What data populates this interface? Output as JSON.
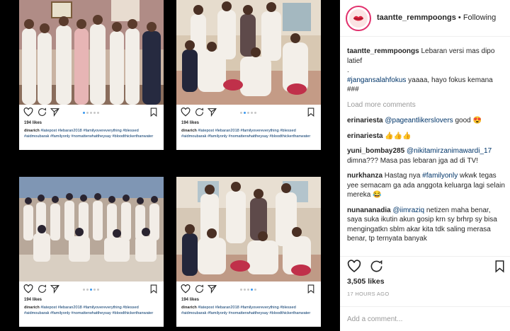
{
  "profile": {
    "username": "taantte_remmpoongs",
    "separator": " • ",
    "follow_status": "Following"
  },
  "cards": [
    {
      "likes": "194 likes",
      "caption_user": "dinarich",
      "caption_text": " #latepost #lebaran2018 #familyovereverything #blessed #aidmoubarak #familyonly #nomatterwhattheysay #bloodthickerthanwater"
    },
    {
      "likes": "194 likes",
      "caption_user": "dinarich",
      "caption_text": " #latepost #lebaran2018 #familyovereverything #blessed #aidmoubarak #familyonly #nomatterwhattheysay #bloodthickerthanwater"
    },
    {
      "likes": "194 likes",
      "caption_user": "dinarich",
      "caption_text": " #latepost #lebaran2018 #familyovereverything #blessed #aidmoubarak #familyonly #nomatterwhattheysay #bloodthickerthanwater"
    },
    {
      "likes": "194 likes",
      "caption_user": "dinarich",
      "caption_text": " #latepost #lebaran2018 #familyovereverything #blessed #aidmoubarak #familyonly #nomatterwhattheysay #bloodthickerthanwater"
    }
  ],
  "caption": {
    "user": "taantte_remmpoongs",
    "text": " Lebaran versi mas dipo latief",
    "trailing": ".",
    "hashtag": "#jangansalahfokus",
    "text2": " yaaaa, hayo fokus kemana ###"
  },
  "load_more": "Load more comments",
  "comments": [
    {
      "user": "erinariesta",
      "mention": "@pageantlikerslovers",
      "text": " good 😍"
    },
    {
      "user": "erinariesta",
      "mention": "",
      "text": " 👍👍👍"
    },
    {
      "user": "yuni_bombay285",
      "mention": "@nikitamirzanimawardi_17",
      "text": " dimna??? Masa pas lebaran jga ad di TV!"
    },
    {
      "user": "nurkhanza",
      "mention": "",
      "text": " Hastag nya ",
      "hashtag": "#familyonly",
      "text2": " wkwk tegas yee semacam ga ada anggota keluarga lagi selain mereka 😂"
    },
    {
      "user": "nunananadia",
      "mention": "@iimraziq",
      "text": " netizen maha benar, saya suka ikutin akun gosip krn sy brhrp sy bisa mengingatkn sblm akar kita tdk saling merasa benar, tp ternyata banyak"
    }
  ],
  "likes_count": "3,505 likes",
  "time_ago": "17 HOURS AGO",
  "add_comment_placeholder": "Add a comment...",
  "icons": [
    "heart-icon",
    "comment-icon",
    "share-icon",
    "bookmark-icon"
  ],
  "colors": {
    "link": "#003569",
    "accent_dot": "#3897f0",
    "story_ring": "#e1306c",
    "muted": "#999999"
  }
}
